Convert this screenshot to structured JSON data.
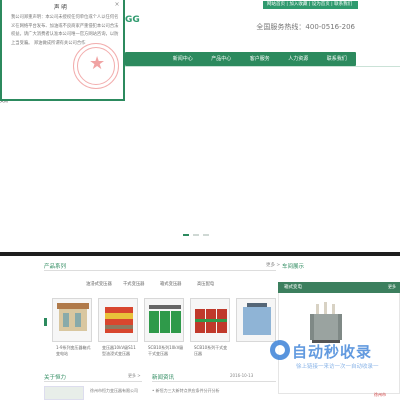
{
  "header": {
    "top_links": "网站首页 | 加入收藏 | 设为首页 | 联系我们",
    "logo_mark": "GG",
    "hotline": "全国服务热线：400-0516-206"
  },
  "nav": {
    "items": [
      "",
      "新闻中心",
      "产品中心",
      "客户服务",
      "人力资源",
      "联系我们"
    ]
  },
  "banner": {
    "label": "关闭"
  },
  "popup": {
    "title": "声 明",
    "close": "×",
    "text": "我公司郑重声明：本公司未授权任何单位或个人以任何名义在网络平台发布、加油或不良商家严重侵犯本公司合法权益。请广大消费者认准本公司唯一官方网站咨询，以防上当受骗。 郑油做成所谓有关公司合作"
  },
  "products": {
    "title": "产品系列",
    "more": "更多 >",
    "tabs": [
      "油浸式变压器",
      "干式变压器",
      "箱式变压器",
      "高压配电"
    ],
    "captions": [
      "1-9系列变压器箱式变电站",
      "变压器10kV级S11型油浸式变压器",
      "SCB10系列10kV级干式变压器",
      "SCB10系列干式变压器"
    ]
  },
  "news": {
    "title": "车间展示",
    "head": "箱式变电",
    "more": "更多"
  },
  "about": {
    "title": "关于恒力",
    "more": "更多 >",
    "text": "徐州市恒力变压器有限公司"
  },
  "news2": {
    "title": "新闻资讯",
    "date": "2016-10-13",
    "item": "•  新恒力三大新特点供应条件分开分析",
    "item2": "2016-10"
  },
  "watermark": {
    "brand": "自动秒收录",
    "sub": "徐上链接一来访一次一自动收录一"
  },
  "corner": "徐州市",
  "colors": {
    "primary": "#2c8a5e",
    "watermark": "#3b82d8"
  }
}
